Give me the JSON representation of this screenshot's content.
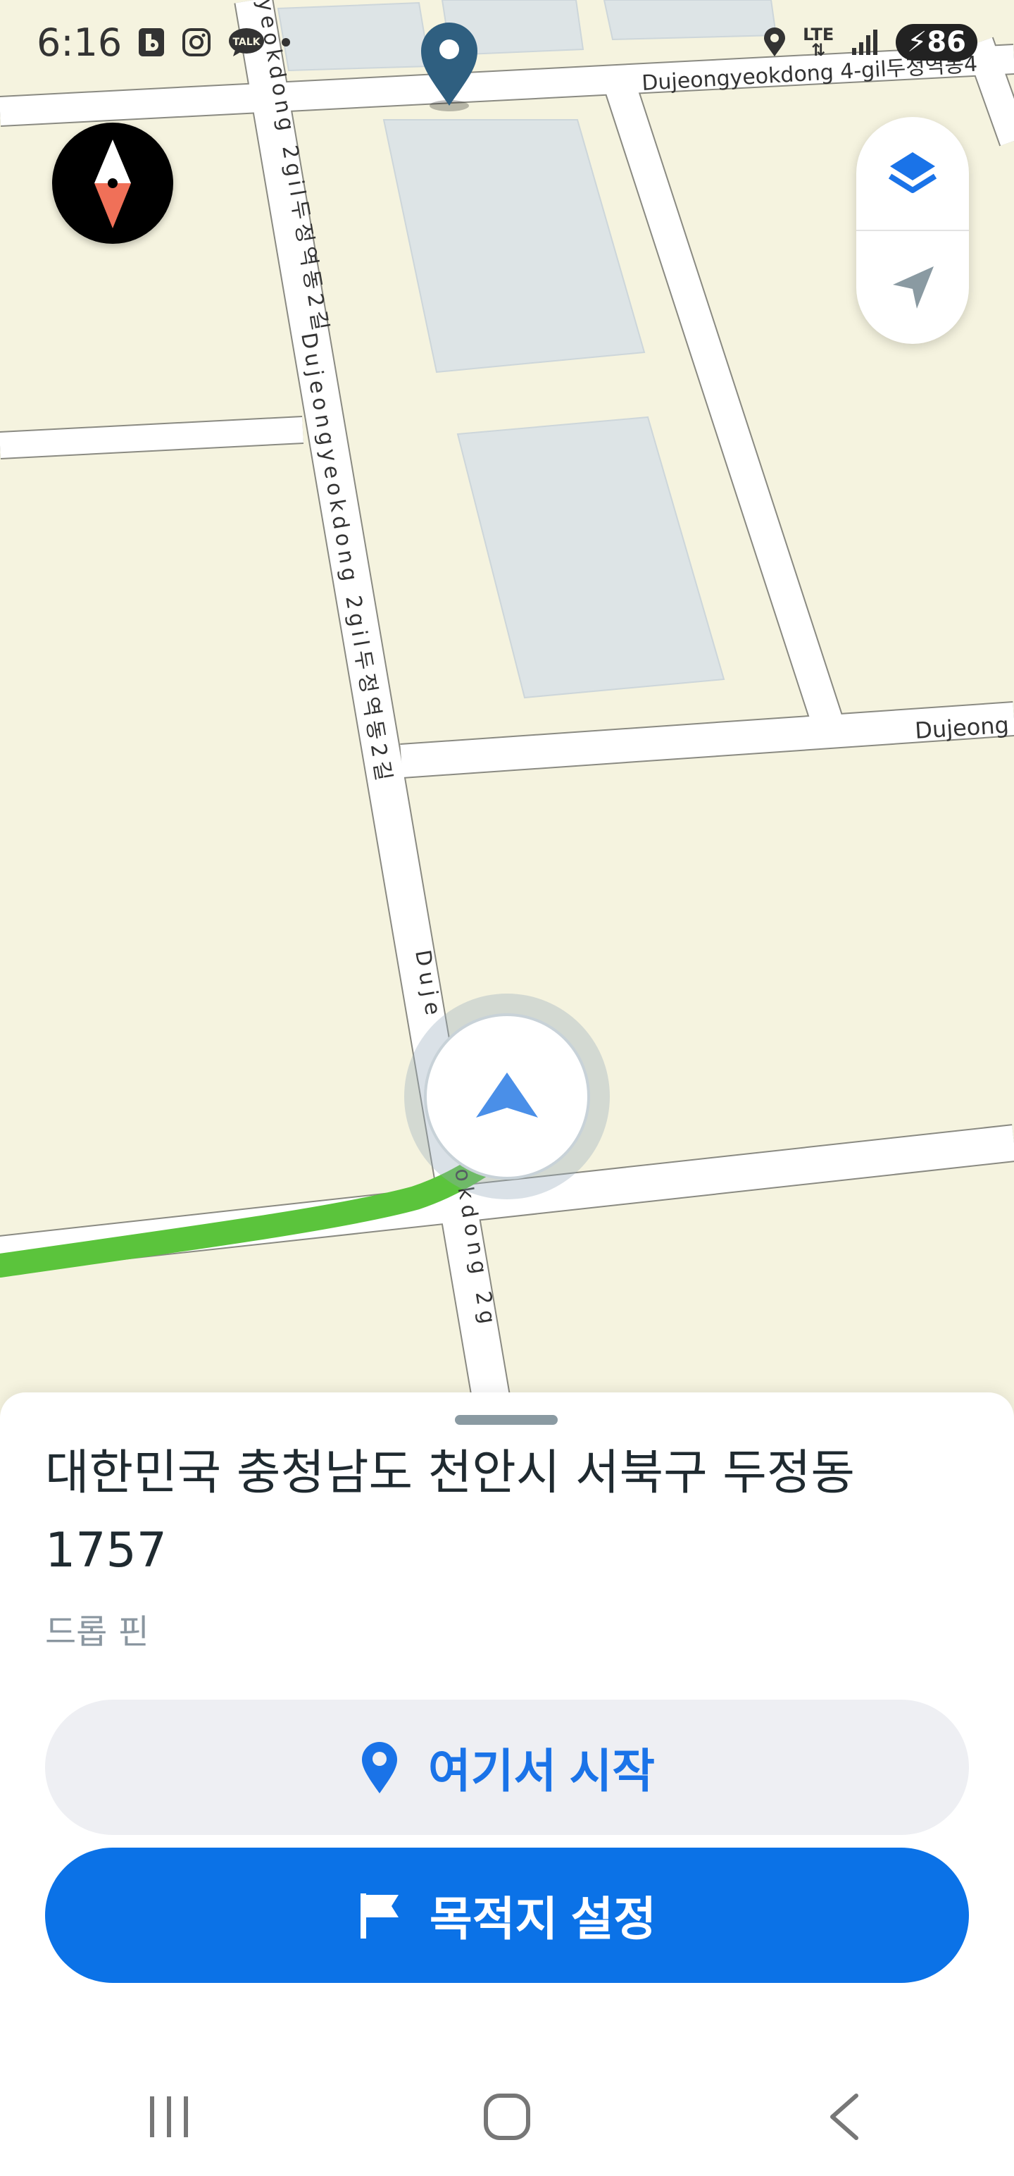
{
  "status_bar": {
    "time": "6:16",
    "network": "LTE",
    "battery": "86",
    "icons": [
      "b-app-icon",
      "instagram-icon",
      "kakaotalk-icon",
      "dot-icon",
      "location-icon",
      "signal-icon",
      "battery-icon"
    ]
  },
  "map": {
    "street_labels": {
      "top_road": "Dujeongyeokdong 4-gil두정역동4",
      "right_road": "Dujeong",
      "left_vertical_top": "yeokdong 2gil두정역동2길",
      "left_vertical_mid": "Dujeongyeokdong 2gil두정역동2길",
      "lower_vertical_a": "Duje",
      "lower_vertical_b": "okdong 2g"
    },
    "colors": {
      "land": "#f5f3df",
      "road": "#ffffff",
      "road_border": "#8a8a82",
      "building": "#dde4e6",
      "route": "#5bc43c",
      "pin": "#2f5f80",
      "location_arrow": "#4a8fe8"
    }
  },
  "controls": {
    "compass_icon": "compass-icon",
    "layers_icon": "layers-icon",
    "locate_icon": "my-location-arrow-icon"
  },
  "sheet": {
    "address": "대한민국 충청남도 천안시 서북구 두정동 1757",
    "subtitle": "드롭 핀",
    "start_label": "여기서 시작",
    "destination_label": "목적지 설정",
    "start_icon": "location-pin-icon",
    "destination_icon": "flag-icon"
  },
  "nav": {
    "recents_icon": "recents-icon",
    "home_icon": "home-icon",
    "back_icon": "back-icon"
  }
}
